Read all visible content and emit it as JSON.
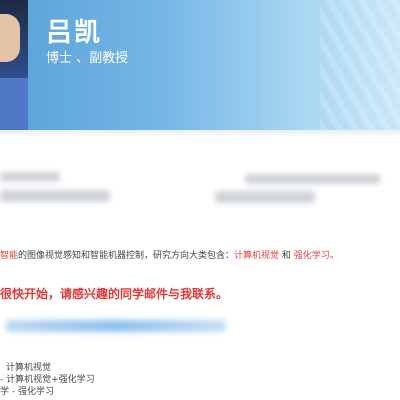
{
  "profile": {
    "name": "吕凯",
    "title": "博士 、副教授"
  },
  "research": {
    "prefix": "智能",
    "text": "的图像视觉感知和智能机器控制，研究方向大类包含：",
    "highlight_1": "计算机视觉",
    "connector": " 和 ",
    "highlight_2": "强化学习。"
  },
  "notice": "很快开始，请感兴趣的同学邮件与我联系。",
  "directions": [
    "计算机视觉",
    "- 计算机视觉+强化学习",
    "学 - 强化学习"
  ],
  "colors": {
    "header_start": "#5aa2d8",
    "header_end": "#c9e8f8",
    "accent_red": "#e03b3b"
  }
}
